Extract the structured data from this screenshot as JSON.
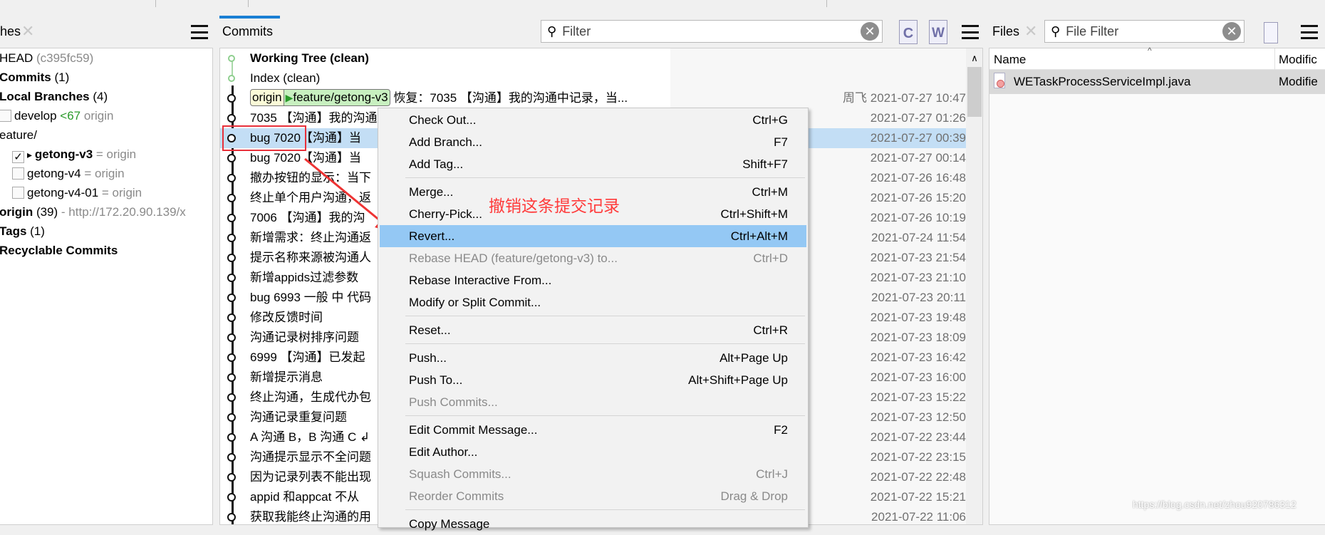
{
  "branches_panel": {
    "title": "hes",
    "items": [
      {
        "label": "HEAD",
        "suffix": " (c395fc59)"
      },
      {
        "label": "Commits",
        "suffix": " (1)"
      },
      {
        "label": "Local Branches",
        "suffix": " (4)"
      },
      {
        "label": "develop",
        "ahead": "<67",
        "suffix": " origin",
        "checked": false
      },
      {
        "label": "eature/"
      },
      {
        "label": "getong-v3",
        "suffix": " = origin",
        "checked": true,
        "current": true
      },
      {
        "label": "getong-v4",
        "suffix": " = origin",
        "checked": false
      },
      {
        "label": "getong-v4-01",
        "suffix": " = origin",
        "checked": false
      },
      {
        "label": "origin",
        "count": " (39)",
        "suffix": " - http://172.20.90.139/x"
      },
      {
        "label": "Tags",
        "suffix": " (1)"
      },
      {
        "label": "Recyclable Commits"
      }
    ]
  },
  "commits_panel": {
    "title": "Commits",
    "filter_placeholder": "Filter",
    "refs": {
      "remote": "origin",
      "branch": "feature/getong-v3"
    },
    "rows": [
      {
        "message": "Working Tree (clean)",
        "date": "",
        "author": ""
      },
      {
        "message": "Index (clean)",
        "date": "",
        "author": ""
      },
      {
        "message": "恢复：7035 【沟通】我的沟通中记录，当...",
        "date": "2021-07-27 10:47",
        "author": "周飞"
      },
      {
        "message": "7035 【沟通】我的沟通",
        "date": "2021-07-27 01:26"
      },
      {
        "message": "bug 7020【沟通】当",
        "date": "2021-07-27 00:39"
      },
      {
        "message": "bug 7020【沟通】当",
        "date": "2021-07-27 00:14"
      },
      {
        "message": "撤办按钮的显示：当下",
        "date": "2021-07-26 16:48"
      },
      {
        "message": "终止单个用户沟通，返",
        "date": "2021-07-26 15:20"
      },
      {
        "message": "7006 【沟通】我的沟",
        "date": "2021-07-26 10:19"
      },
      {
        "message": "新增需求：终止沟通返",
        "date": "2021-07-24 11:54"
      },
      {
        "message": "提示名称来源被沟通人",
        "date": "2021-07-23 21:54"
      },
      {
        "message": "新增appids过滤参数",
        "date": "2021-07-23 21:10"
      },
      {
        "message": "bug  6993 一般 中 代码",
        "date": "2021-07-23 20:11"
      },
      {
        "message": "修改反馈时间",
        "date": "2021-07-23 19:48"
      },
      {
        "message": "沟通记录树排序问题",
        "date": "2021-07-23 18:09"
      },
      {
        "message": "6999 【沟通】已发起",
        "date": "2021-07-23 16:42"
      },
      {
        "message": "新增提示消息",
        "date": "2021-07-23 16:00"
      },
      {
        "message": "终止沟通，生成代办包",
        "date": "2021-07-23 15:22"
      },
      {
        "message": "沟通记录重复问题",
        "date": "2021-07-23 12:50"
      },
      {
        "message": "A 沟通 B，B 沟通 C ↲",
        "date": "2021-07-22 23:44"
      },
      {
        "message": "沟通提示显示不全问题",
        "date": "2021-07-22 23:15"
      },
      {
        "message": "因为记录列表不能出现",
        "date": "2021-07-22 22:48"
      },
      {
        "message": "appid 和appcat  不从",
        "date": "2021-07-22 15:21"
      },
      {
        "message": "获取我能终止沟通的用",
        "date": "2021-07-22 11:06"
      }
    ],
    "selected_row": 4
  },
  "context_menu": {
    "items": [
      {
        "label": "Check Out...",
        "shortcut": "Ctrl+G"
      },
      {
        "label": "Add Branch...",
        "shortcut": "F7"
      },
      {
        "label": "Add Tag...",
        "shortcut": "Shift+F7"
      },
      {
        "separator": true
      },
      {
        "label": "Merge...",
        "shortcut": "Ctrl+M"
      },
      {
        "label": "Cherry-Pick...",
        "shortcut": "Ctrl+Shift+M"
      },
      {
        "label": "Revert...",
        "shortcut": "Ctrl+Alt+M",
        "highlighted": true
      },
      {
        "label": "Rebase HEAD (feature/getong-v3) to...",
        "shortcut": "Ctrl+D",
        "disabled": true
      },
      {
        "label": "Rebase Interactive From...",
        "shortcut": ""
      },
      {
        "label": "Modify or Split Commit...",
        "shortcut": ""
      },
      {
        "separator": true
      },
      {
        "label": "Reset...",
        "shortcut": "Ctrl+R"
      },
      {
        "separator": true
      },
      {
        "label": "Push...",
        "shortcut": "Alt+Page Up"
      },
      {
        "label": "Push To...",
        "shortcut": "Alt+Shift+Page Up"
      },
      {
        "label": "Push Commits...",
        "shortcut": "",
        "disabled": true
      },
      {
        "separator": true
      },
      {
        "label": "Edit Commit Message...",
        "shortcut": "F2"
      },
      {
        "label": "Edit Author...",
        "shortcut": ""
      },
      {
        "label": "Squash Commits...",
        "shortcut": "Ctrl+J",
        "disabled": true
      },
      {
        "label": "Reorder Commits",
        "shortcut": "Drag & Drop",
        "disabled": true
      },
      {
        "separator": true
      },
      {
        "label": "Copy Message",
        "shortcut": ""
      }
    ]
  },
  "annotation": {
    "text": "撤销这条提交记录",
    "color": "#ff3b3b"
  },
  "files_panel": {
    "title": "Files",
    "filter_placeholder": "File Filter",
    "columns": [
      "Name",
      "Modific"
    ],
    "rows": [
      {
        "name": "WETaskProcessServiceImpl.java",
        "status": "Modifie"
      }
    ]
  },
  "watermark": "https://blog.csdn.net/zhou920786312",
  "colors": {
    "accent": "#1a7fd4",
    "selection": "#c3def5",
    "menu_highlight": "#94c8f4",
    "annotation": "#ff3b3b"
  }
}
